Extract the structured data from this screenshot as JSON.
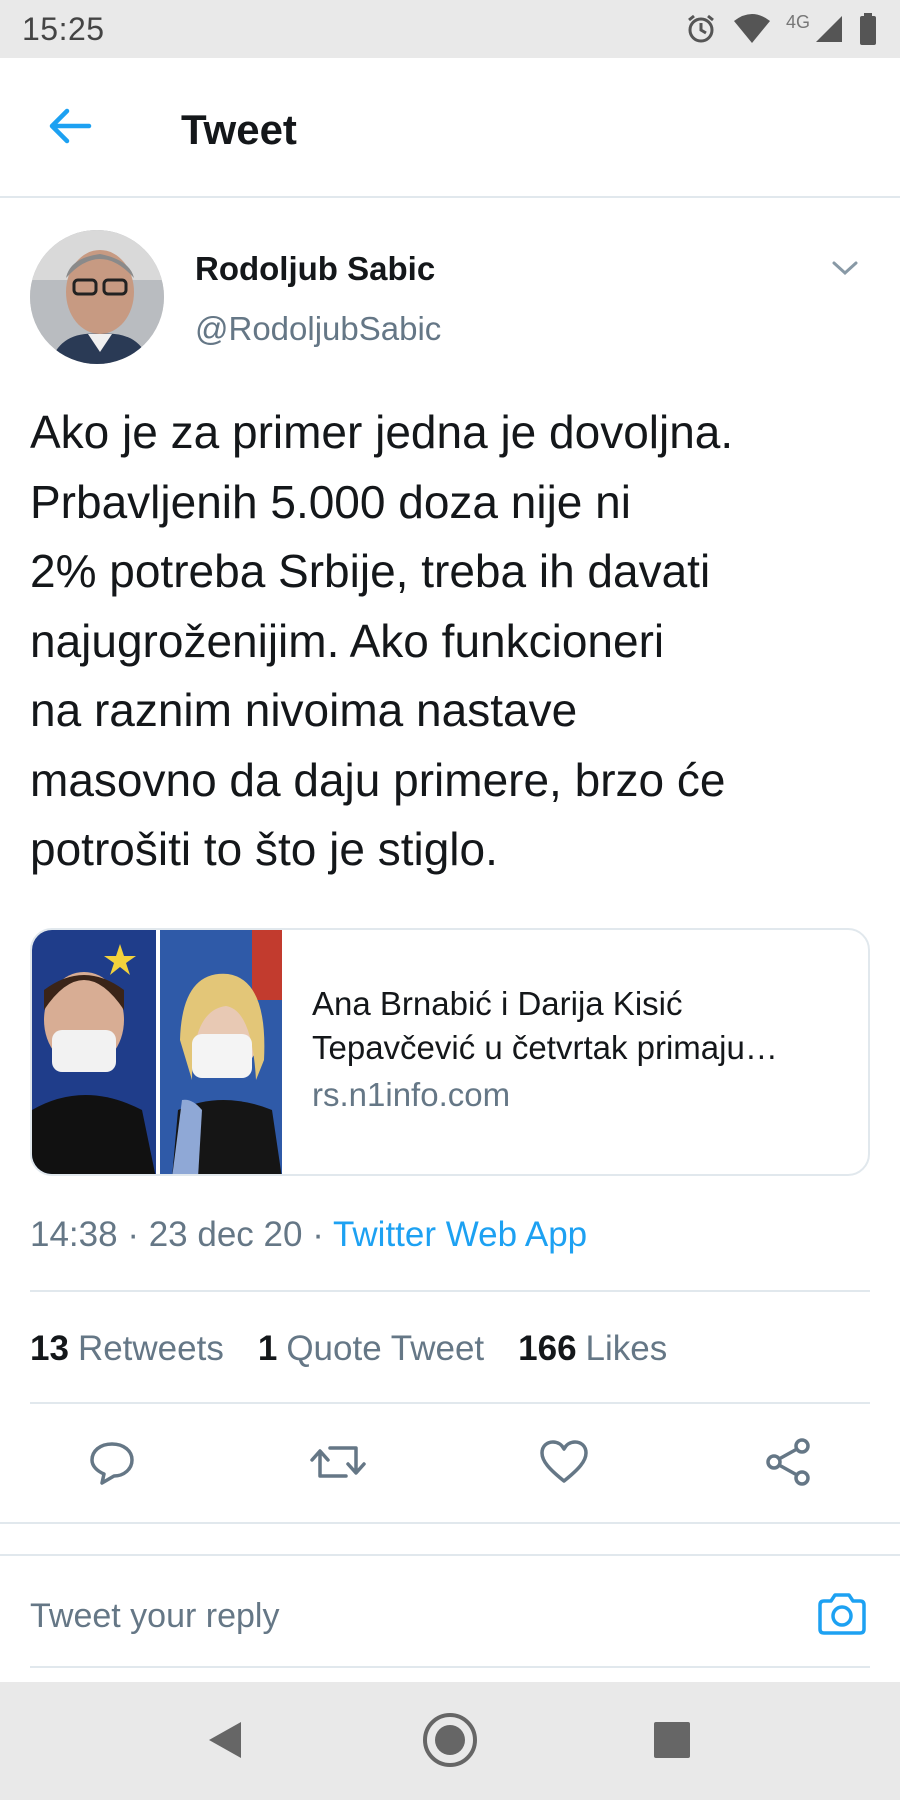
{
  "status_bar": {
    "time": "15:25",
    "network": "4G",
    "icons": [
      "alarm-icon",
      "wifi-icon",
      "signal-icon",
      "battery-icon"
    ]
  },
  "header": {
    "title": "Tweet",
    "back_icon": "arrow-left-icon"
  },
  "tweet": {
    "author_name": "Rodoljub Sabic",
    "author_handle": "@RodoljubSabic",
    "text": "Ako je za primer jedna je dovoljna.\nPrbavljenih 5.000 doza nije ni\n2% potreba Srbije, treba ih davati\nnajugroženijim. Ako funkcioneri\nna raznim nivoima nastave\nmasovno da daju primere, brzo će\npotrošiti to što je stiglo.",
    "card": {
      "title": "Ana Brnabić i Darija Kisić Tepavčević u četvrtak primaju…",
      "domain": "rs.n1info.com"
    },
    "time": "14:38",
    "date": "23 dec 20",
    "separator": "·",
    "source": "Twitter Web App",
    "stats": {
      "retweets_count": "13",
      "retweets_label": "Retweets",
      "quotes_count": "1",
      "quotes_label": "Quote Tweet",
      "likes_count": "166",
      "likes_label": "Likes"
    }
  },
  "actions": [
    "reply-icon",
    "retweet-icon",
    "like-icon",
    "share-icon"
  ],
  "reply": {
    "placeholder": "Tweet your reply"
  },
  "colors": {
    "accent": "#1da1f2",
    "secondary_text": "#657786",
    "divider": "#e1e8ed"
  }
}
